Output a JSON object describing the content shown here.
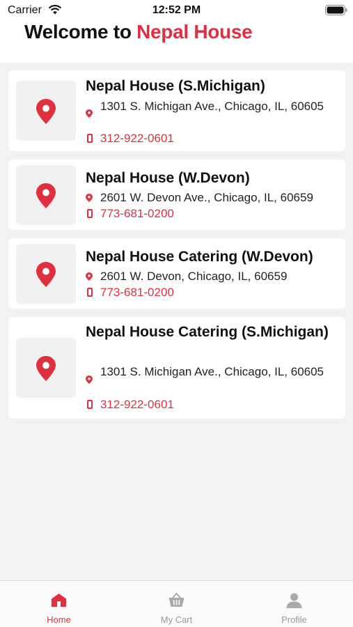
{
  "status_bar": {
    "carrier": "Carrier",
    "time": "12:52 PM"
  },
  "header": {
    "title_prefix": "Welcome to ",
    "title_brand": "Nepal House"
  },
  "colors": {
    "accent": "#e0303f"
  },
  "locations": [
    {
      "name": "Nepal House (S.Michigan)",
      "address": "1301 S. Michigan Ave., Chicago, IL, 60605",
      "phone": "312-922-0601"
    },
    {
      "name": "Nepal House (W.Devon)",
      "address": "2601 W. Devon Ave., Chicago, IL, 60659",
      "phone": "773-681-0200"
    },
    {
      "name": "Nepal House Catering (W.Devon)",
      "address": "2601 W. Devon, Chicago, IL, 60659",
      "phone": "773-681-0200"
    },
    {
      "name": "Nepal House Catering (S.Michigan)",
      "address": "1301 S. Michigan Ave., Chicago, IL, 60605",
      "phone": "312-922-0601"
    }
  ],
  "tabs": [
    {
      "label": "Home",
      "icon": "home-icon",
      "active": true
    },
    {
      "label": "My Cart",
      "icon": "basket-icon",
      "active": false
    },
    {
      "label": "Profile",
      "icon": "person-icon",
      "active": false
    }
  ]
}
